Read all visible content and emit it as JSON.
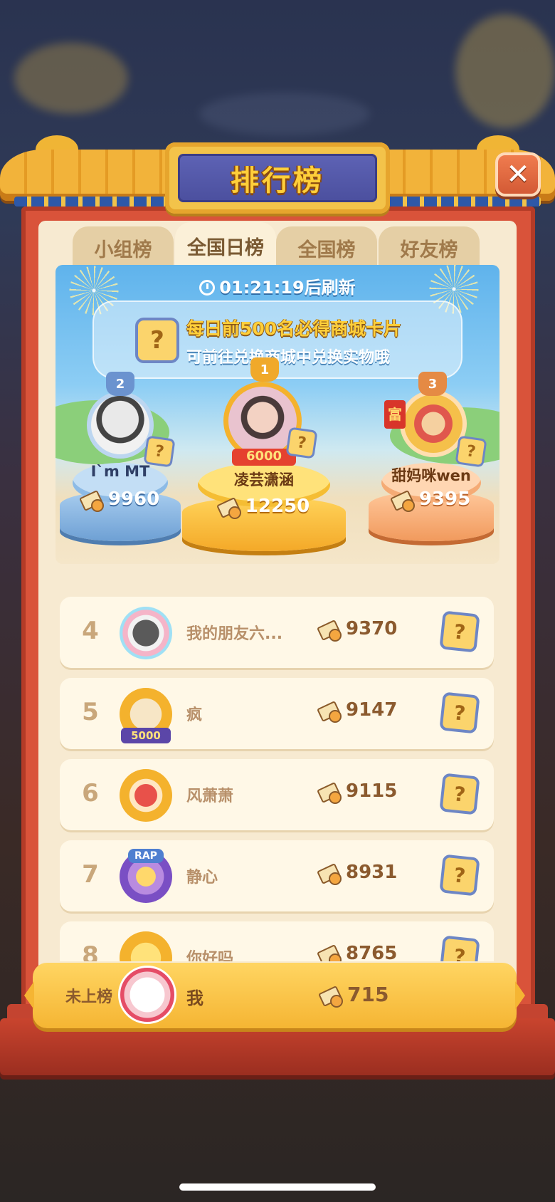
{
  "title": "排行榜",
  "close_label": "✕",
  "tabs": [
    {
      "label": "小组榜",
      "active": false
    },
    {
      "label": "全国日榜",
      "active": true
    },
    {
      "label": "全国榜",
      "active": false
    },
    {
      "label": "好友榜",
      "active": false
    }
  ],
  "banner": {
    "timer": "01:21:19后刷新",
    "notice_line1": "每日前500名必得商城卡片",
    "notice_line2": "可前往兑换商城中兑换实物哦",
    "card_symbol": "?"
  },
  "podium": {
    "first": {
      "rank": "1",
      "name": "凌芸潇涵",
      "score": "12250",
      "frame_tag": "6000"
    },
    "second": {
      "rank": "2",
      "name": "I`m MT",
      "score": "9960"
    },
    "third": {
      "rank": "3",
      "name": "甜妈咪wen",
      "score": "9395",
      "tag": "富"
    }
  },
  "list": [
    {
      "rank": "4",
      "name": "我的朋友六...",
      "score": "9370"
    },
    {
      "rank": "5",
      "name": "疯",
      "score": "9147",
      "frame_tag": "5000"
    },
    {
      "rank": "6",
      "name": "风萧萧",
      "score": "9115"
    },
    {
      "rank": "7",
      "name": "静心",
      "score": "8931",
      "frame_tag": "RAP"
    },
    {
      "rank": "8",
      "name": "你好吗",
      "score": "8765"
    }
  ],
  "me": {
    "rank_label": "未上榜",
    "name": "我",
    "score": "715"
  },
  "card_symbol": "?",
  "colors": {
    "accent": "#f5b533",
    "frame": "#d9533a",
    "title_bg": "#4b4f9e"
  }
}
